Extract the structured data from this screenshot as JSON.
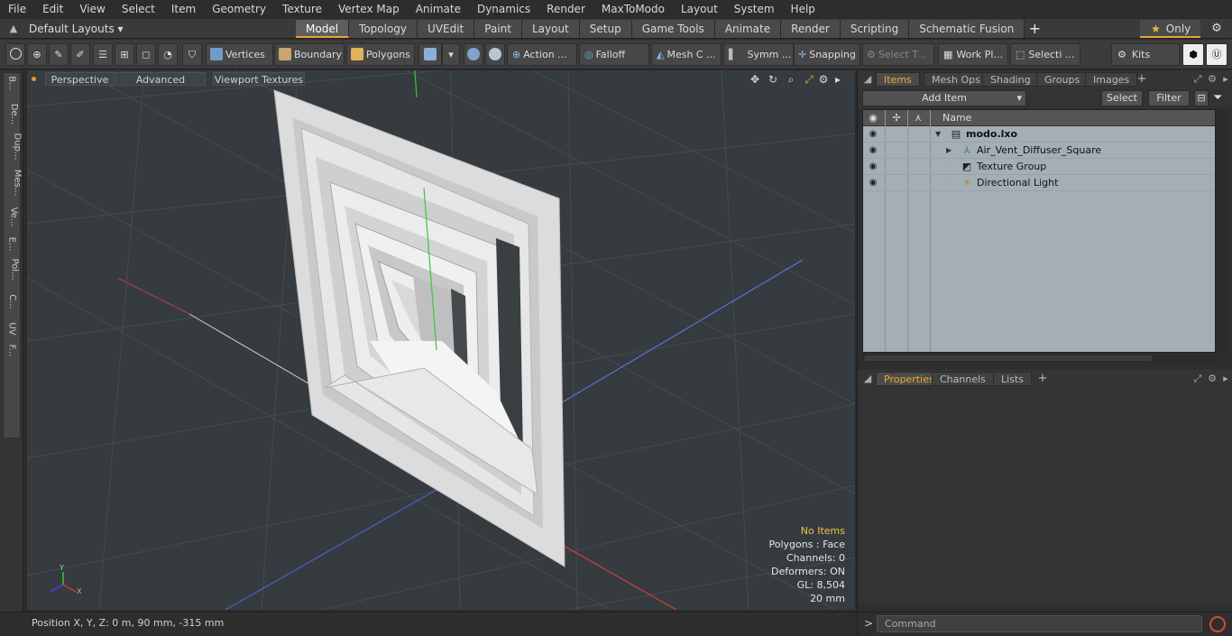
{
  "menu": [
    "File",
    "Edit",
    "View",
    "Select",
    "Item",
    "Geometry",
    "Texture",
    "Vertex Map",
    "Animate",
    "Dynamics",
    "Render",
    "MaxToModo",
    "Layout",
    "System",
    "Help"
  ],
  "layout_bar": {
    "layout_dropdown": "Default Layouts ▾",
    "tabs": [
      "Model",
      "Topology",
      "UVEdit",
      "Paint",
      "Layout",
      "Setup",
      "Game Tools",
      "Animate",
      "Render",
      "Scripting",
      "Schematic Fusion"
    ],
    "active_tab": "Model",
    "only_label": "Only"
  },
  "toolbar": {
    "vertices": "Vertices",
    "boundary": "Boundary",
    "polygons": "Polygons",
    "action": "Action ...",
    "falloff": "Falloff",
    "mesh": "Mesh C ...",
    "symm": "Symm ...",
    "snapping": "Snapping",
    "select_t": "Select T...",
    "work_pl": "Work Pl...",
    "selecti": "Selecti ...",
    "kits": "Kits"
  },
  "left_tabs": [
    "B...",
    "De...",
    "Dup...",
    "Mes...",
    "Ve...",
    "E...",
    "Pol...",
    "C...",
    "UV",
    "F..."
  ],
  "viewport": {
    "tabs": [
      "Perspective",
      "Advanced",
      "Viewport Textures"
    ],
    "info": {
      "selection": "No Items",
      "polygons": "Polygons : Face",
      "channels": "Channels: 0",
      "deformers": "Deformers: ON",
      "gl": "GL: 8,504",
      "unit": "20 mm"
    }
  },
  "status": {
    "position": "Position X, Y, Z:   0 m, 90 mm, -315 mm"
  },
  "items_panel": {
    "tabs": [
      "Items",
      "Mesh Ops",
      "Shading",
      "Groups",
      "Images"
    ],
    "active_tab": "Items",
    "add_item": "Add Item",
    "select": "Select",
    "filter": "Filter",
    "column_name": "Name",
    "rows": [
      {
        "label": "modo.lxo",
        "bold": true
      },
      {
        "label": "Air_Vent_Diffuser_Square",
        "bold": false
      },
      {
        "label": "Texture Group",
        "bold": false
      },
      {
        "label": "Directional Light",
        "bold": false
      }
    ]
  },
  "props_panel": {
    "tabs": [
      "Properties",
      "Channels",
      "Lists"
    ],
    "active_tab": "Properties"
  },
  "command": {
    "placeholder": "Command"
  },
  "colors": {
    "accent": "#e8a33a",
    "viewport_bg": "#353b3e",
    "tree_bg": "#a3aeb5",
    "info_highlight": "#f0c34a"
  }
}
